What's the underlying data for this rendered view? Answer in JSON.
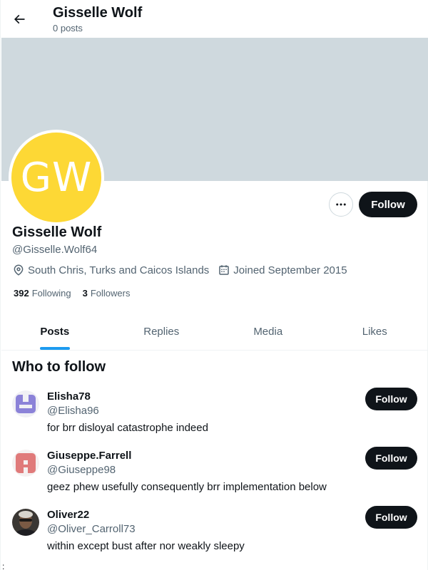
{
  "header": {
    "title": "Gisselle Wolf",
    "subtitle": "0 posts"
  },
  "profile": {
    "avatar_initials": "GW",
    "avatar_color": "#fdd835",
    "banner_color": "#cfd9de",
    "name": "Gisselle Wolf",
    "handle": "@Gisselle.Wolf64",
    "location": "South Chris, Turks and Caicos Islands",
    "joined": "Joined September 2015",
    "following_count": "392",
    "following_label": "Following",
    "followers_count": "3",
    "followers_label": "Followers",
    "more_label": "···",
    "follow_label": "Follow"
  },
  "tabs": [
    {
      "label": "Posts",
      "active": true
    },
    {
      "label": "Replies",
      "active": false
    },
    {
      "label": "Media",
      "active": false
    },
    {
      "label": "Likes",
      "active": false
    }
  ],
  "who_to_follow": {
    "title": "Who to follow",
    "items": [
      {
        "name": "Elisha78",
        "handle": "@Elisha96",
        "bio": "for brr disloyal catastrophe indeed",
        "follow_label": "Follow",
        "avatar": "identicon-purple"
      },
      {
        "name": "Giuseppe.Farrell",
        "handle": "@Giuseppe98",
        "bio": "geez phew usefully consequently brr implementation below",
        "follow_label": "Follow",
        "avatar": "identicon-red"
      },
      {
        "name": "Oliver22",
        "handle": "@Oliver_Carroll73",
        "bio": "within except bust after nor weakly sleepy",
        "follow_label": "Follow",
        "avatar": "photo"
      }
    ]
  },
  "footer_mark": ":"
}
